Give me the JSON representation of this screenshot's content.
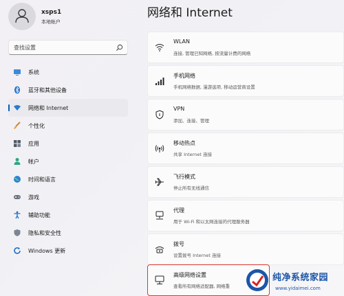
{
  "profile": {
    "name": "xsps1",
    "account_type": "本地帐户"
  },
  "search": {
    "placeholder": "查找设置"
  },
  "sidebar": {
    "items": [
      {
        "label": "系统",
        "icon": "monitor-icon"
      },
      {
        "label": "蓝牙和其他设备",
        "icon": "bluetooth-icon"
      },
      {
        "label": "网络和 Internet",
        "icon": "wifi-diamond-icon",
        "active": true
      },
      {
        "label": "个性化",
        "icon": "brush-icon"
      },
      {
        "label": "应用",
        "icon": "apps-icon"
      },
      {
        "label": "帐户",
        "icon": "person-icon"
      },
      {
        "label": "时间和语言",
        "icon": "globe-clock-icon"
      },
      {
        "label": "游戏",
        "icon": "gamepad-icon"
      },
      {
        "label": "辅助功能",
        "icon": "accessibility-icon"
      },
      {
        "label": "隐私和安全性",
        "icon": "shield-icon"
      },
      {
        "label": "Windows 更新",
        "icon": "update-icon"
      }
    ]
  },
  "main": {
    "title": "网络和 Internet",
    "cards": [
      {
        "title": "WLAN",
        "desc": "连接, 管理已知网络, 按流量计费的网络",
        "icon": "wifi-icon"
      },
      {
        "title": "手机网络",
        "desc": "手机网络数据, 漫游选项, 移动运营商设置",
        "icon": "cellular-icon"
      },
      {
        "title": "VPN",
        "desc": "添加、连接、管理",
        "icon": "vpn-shield-icon"
      },
      {
        "title": "移动热点",
        "desc": "共享 Internet 连接",
        "icon": "hotspot-icon"
      },
      {
        "title": "飞行模式",
        "desc": "停止所有无线通信",
        "icon": "airplane-icon"
      },
      {
        "title": "代理",
        "desc": "用于 Wi-Fi 和以太网连接的代理服务器",
        "icon": "proxy-icon"
      },
      {
        "title": "拨号",
        "desc": "设置拨号 Internet 连接",
        "icon": "dialup-icon"
      },
      {
        "title": "高级网络设置",
        "desc": "查看所有网络适配器, 网络重",
        "icon": "advanced-network-icon",
        "highlighted": true
      }
    ]
  },
  "watermark": {
    "title": "纯净系统家园",
    "url": "www.yidaimei.com"
  },
  "colors": {
    "accent": "#005fb8",
    "highlight_border": "#d8362c",
    "watermark_blue": "#1c56a8"
  }
}
